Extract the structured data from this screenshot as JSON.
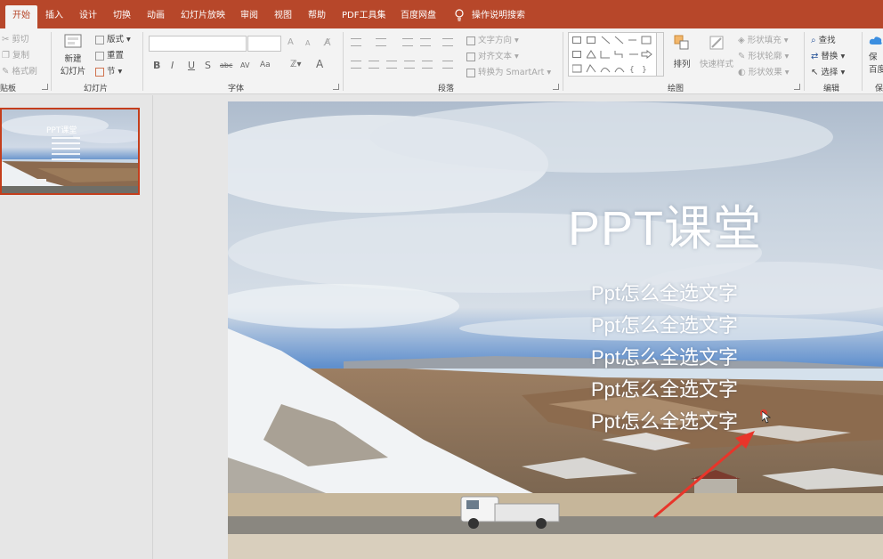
{
  "tabs": [
    {
      "label": "开始",
      "active": true
    },
    {
      "label": "插入"
    },
    {
      "label": "设计"
    },
    {
      "label": "切换"
    },
    {
      "label": "动画"
    },
    {
      "label": "幻灯片放映"
    },
    {
      "label": "审阅"
    },
    {
      "label": "视图"
    },
    {
      "label": "帮助"
    },
    {
      "label": "PDF工具集"
    },
    {
      "label": "百度网盘"
    },
    {
      "label": "操作说明搜索"
    }
  ],
  "ribbon": {
    "clipboard": {
      "cut": "剪切",
      "copy": "复制",
      "format_painter": "格式刷",
      "label": "贴板"
    },
    "slides": {
      "new_slide_line1": "新建",
      "new_slide_line2": "幻灯片",
      "layout": "版式",
      "reset": "重置",
      "section": "节",
      "label": "幻灯片"
    },
    "font": {
      "label": "字体",
      "bold": "B",
      "italic": "I",
      "underline": "U",
      "shadow": "S",
      "strike": "abc",
      "char_spacing": "AV",
      "case": "Aa",
      "color": "A",
      "grow": "A",
      "shrink": "A"
    },
    "paragraph": {
      "text_direction": "文字方向",
      "align_text": "对齐文本",
      "smartart": "转换为 SmartArt",
      "label": "段落"
    },
    "drawing": {
      "arrange": "排列",
      "quick_styles": "快速样式",
      "shape_fill": "形状填充",
      "shape_outline": "形状轮廓",
      "shape_effects": "形状效果",
      "label": "绘图"
    },
    "editing": {
      "find": "查找",
      "replace": "替换",
      "select": "选择",
      "label": "编辑"
    },
    "save": {
      "line1": "保",
      "line2": "百度",
      "label": "保"
    }
  },
  "slide": {
    "title": "PPT课堂",
    "lines": [
      "Ppt怎么全选文字",
      "Ppt怎么全选文字",
      "Ppt怎么全选文字",
      "Ppt怎么全选文字",
      "Ppt怎么全选文字"
    ]
  },
  "thumbnail": {
    "title": "PPT课堂"
  },
  "colors": {
    "accent": "#b7472a",
    "annotation": "#e8352a"
  }
}
